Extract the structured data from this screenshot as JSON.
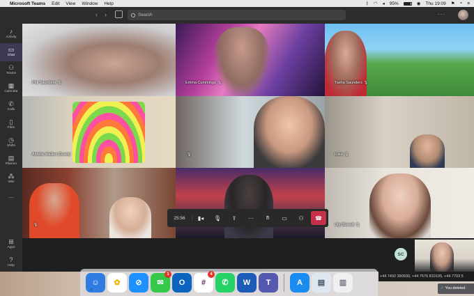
{
  "menubar": {
    "app_name": "Microsoft Teams",
    "items": [
      "Edit",
      "View",
      "Window",
      "Help"
    ],
    "battery": "95%",
    "clock": "Thu 19:09"
  },
  "header": {
    "search_placeholder": "Search"
  },
  "rail": [
    {
      "label": "Activity",
      "icon": "bell-icon",
      "active": false
    },
    {
      "label": "Chat",
      "icon": "chat-icon",
      "active": true
    },
    {
      "label": "Teams",
      "icon": "teams-icon",
      "active": false
    },
    {
      "label": "Calendar",
      "icon": "calendar-icon",
      "active": false
    },
    {
      "label": "Calls",
      "icon": "phone-icon",
      "active": false
    },
    {
      "label": "Files",
      "icon": "file-icon",
      "active": false
    },
    {
      "label": "Shifts",
      "icon": "clock-icon",
      "active": false
    },
    {
      "label": "Planner",
      "icon": "planner-icon",
      "active": false
    },
    {
      "label": "Wiki",
      "icon": "wiki-icon",
      "active": false
    }
  ],
  "rail_bottom": [
    {
      "label": "Apps",
      "icon": "apps-icon"
    },
    {
      "label": "Help",
      "icon": "help-icon"
    }
  ],
  "participants": [
    {
      "name": "Phil Saunders",
      "muted": true
    },
    {
      "name": "Emma Cummings",
      "muted": true
    },
    {
      "name": "Tasha Saunders",
      "muted": true
    },
    {
      "name": "Amelia Walker (Guest)",
      "muted": false
    },
    {
      "name": "",
      "muted": true
    },
    {
      "name": "Luke",
      "muted": true
    },
    {
      "name": "",
      "muted": true
    },
    {
      "name": "",
      "muted": false
    },
    {
      "name": "Lily (Guest)",
      "muted": true
    }
  ],
  "call": {
    "timer": "25:56",
    "controls": [
      "camera-icon",
      "microphone-icon",
      "share-screen-icon",
      "more-icon",
      "raise-hand-icon",
      "chat-icon",
      "participants-icon",
      "hang-up-icon"
    ]
  },
  "self_initials": "SC",
  "dock": [
    {
      "name": "finder-icon",
      "color": "#2f7de1",
      "glyph": "☺",
      "badge": ""
    },
    {
      "name": "photos-icon",
      "color": "#f4b400",
      "glyph": "✿",
      "badge": ""
    },
    {
      "name": "safari-icon",
      "color": "#1e90ff",
      "glyph": "⊘",
      "badge": ""
    },
    {
      "name": "messages-icon",
      "color": "#36c84a",
      "glyph": "✉",
      "badge": "1"
    },
    {
      "name": "outlook-icon",
      "color": "#0a64c0",
      "glyph": "O",
      "badge": ""
    },
    {
      "name": "slack-icon",
      "color": "#ffffff",
      "glyph": "#",
      "badge": "4"
    },
    {
      "name": "whatsapp-icon",
      "color": "#25d366",
      "glyph": "✆",
      "badge": ""
    },
    {
      "name": "word-icon",
      "color": "#1d5bb8",
      "glyph": "W",
      "badge": ""
    },
    {
      "name": "teams-icon",
      "color": "#5558af",
      "glyph": "T",
      "badge": ""
    },
    {
      "name": "app-store-icon",
      "color": "#1a8cf0",
      "glyph": "A",
      "badge": ""
    },
    {
      "name": "preview-icon",
      "color": "#dfe8f0",
      "glyph": "▤",
      "badge": ""
    },
    {
      "name": "trash-icon",
      "color": "#eef0f2",
      "glyph": "🗑",
      "badge": ""
    }
  ],
  "phone_strip": "+44 7492 390930, +44 7576 810105, +44 7703 5",
  "toast": "You deleted"
}
